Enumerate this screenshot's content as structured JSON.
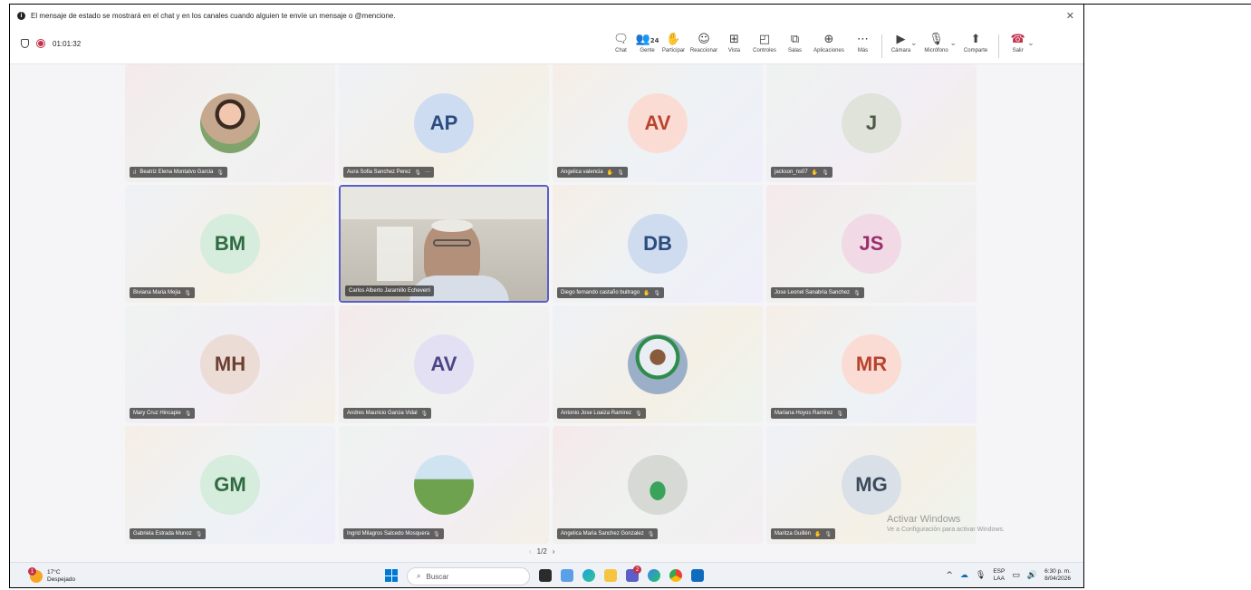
{
  "notice": {
    "text": "El mensaje de estado se mostrará en el chat y en los canales cuando alguien te envíe un mensaje o @mencione."
  },
  "meeting": {
    "timer": "01:01:32"
  },
  "toolbar": {
    "chat": "Chat",
    "people_count": "24",
    "people": "Gente",
    "raise": "Participar",
    "react": "Reaccionar",
    "view": "Vista",
    "controls": "Controles",
    "rooms": "Salas",
    "apps": "Aplicaciones",
    "more": "Más",
    "camera": "Cámara",
    "mic": "Micrófono",
    "share": "Comparte",
    "leave": "Salir"
  },
  "participants": [
    {
      "name": "Beatriz Elena Montalvo Garcia",
      "initials": "",
      "avatar_color": "#d9a896",
      "text_color": "#ffffff"
    },
    {
      "name": "Aura Sofia Sanchez Perez",
      "initials": "AP",
      "avatar_color": "#cddcf0",
      "text_color": "#2b4c7e",
      "extra": "···"
    },
    {
      "name": "Angelica valencia",
      "initials": "AV",
      "avatar_color": "#fbdcd4",
      "text_color": "#b8432e"
    },
    {
      "name": "jackson_ns07",
      "initials": "J",
      "avatar_color": "#dfe3da",
      "text_color": "#4d5a45"
    },
    {
      "name": "Biviana Maria Mejia",
      "initials": "BM",
      "avatar_color": "#d6ecdc",
      "text_color": "#2e6b42"
    },
    {
      "name": "Carlos Alberto Jaramillo Echeverri",
      "initials": "",
      "avatar_color": "#c8c4bb",
      "text_color": "#ffffff"
    },
    {
      "name": "Diego fernando castaño buitrago",
      "initials": "DB",
      "avatar_color": "#cfdcef",
      "text_color": "#2b4c7e"
    },
    {
      "name": "Jose Leonel Sanabria Sanchez",
      "initials": "JS",
      "avatar_color": "#f2d9e6",
      "text_color": "#9a2f6b"
    },
    {
      "name": "Mary Cruz Hincapie",
      "initials": "MH",
      "avatar_color": "#ecdcd6",
      "text_color": "#6b3f31"
    },
    {
      "name": "Andres Mauricio Garcia Vidal",
      "initials": "AV",
      "avatar_color": "#e3e0f3",
      "text_color": "#4a4585"
    },
    {
      "name": "Antonio Jose Loaiza Ramirez",
      "initials": "",
      "avatar_color": "#a9b7c9",
      "text_color": "#ffffff"
    },
    {
      "name": "Mariana Hoyos Ramirez",
      "initials": "MR",
      "avatar_color": "#fbdcd4",
      "text_color": "#b8432e"
    },
    {
      "name": "Gabriela Estrada Munoz",
      "initials": "GM",
      "avatar_color": "#d6ecdc",
      "text_color": "#2e6b42"
    },
    {
      "name": "Ingrid Milagros Salcedo Mosquera",
      "initials": "",
      "avatar_color": "#8fbf6f",
      "text_color": "#ffffff"
    },
    {
      "name": "Angelica Maria Sanchez Gonzalez",
      "initials": "",
      "avatar_color": "#cfd3cf",
      "text_color": "#ffffff"
    },
    {
      "name": "Maritza Guillén",
      "initials": "MG",
      "avatar_color": "#d9e0e8",
      "text_color": "#3b4b5c"
    }
  ],
  "pager": {
    "text": "1/2"
  },
  "watermark": {
    "title": "Activar Windows",
    "subtitle": "Ve a Configuración para activar Windows."
  },
  "taskbar": {
    "temp": "17°C",
    "condition": "Despejado",
    "weather_badge": "1",
    "search": "Buscar",
    "lang": "ESP",
    "layout": "LAA",
    "time": "6:30 p. m.",
    "date": "8/04/2026",
    "teams_badge": "2"
  },
  "colors": {
    "accent": "#5b5fc7",
    "recording": "#c4314b",
    "leave": "#c4314b"
  }
}
